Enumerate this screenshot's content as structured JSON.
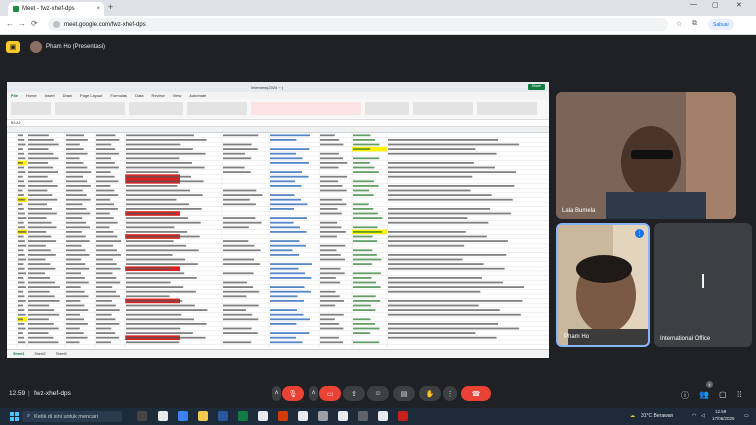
{
  "browser": {
    "tab_title": "Meet - fwz-xhef-dps",
    "tab_close": "×",
    "new_tab": "+",
    "address": "meet.google.com/fwz-xhef-dps",
    "profile_label": "Sabuai",
    "nav_back": "←",
    "nav_forward": "→",
    "nav_reload": "⟳",
    "win_min": "—",
    "win_max": "▢",
    "win_close": "✕"
  },
  "meet": {
    "presenter_label": "Pham Ho (Presentasi)",
    "participants": [
      {
        "name": "Lala Bumela"
      },
      {
        "name": "Pham Ho"
      },
      {
        "name": "International Office",
        "initial": "I"
      }
    ],
    "time": "12.59",
    "separator": "|",
    "meeting_code": "fwz-xhef-dps",
    "participant_count": "4"
  },
  "excel": {
    "title": "Interview(2024 ~ )",
    "menu": [
      "File",
      "Home",
      "Insert",
      "Draw",
      "Page Layout",
      "Formulas",
      "Data",
      "Review",
      "View",
      "Automate"
    ],
    "share_label": "Share",
    "formula_ref": "B2:A2",
    "sheets": [
      "Sheet1",
      "Sheet2",
      "Sheet3"
    ]
  },
  "taskbar": {
    "search_placeholder": "Ketik di sini untuk mencari",
    "weather": "31°C Berawan",
    "clock_time": "12.59",
    "clock_date": "17/06/2025"
  },
  "colors": {
    "meet_bg": "#202124",
    "excel_green": "#107c41",
    "hangup_red": "#ea4335",
    "highlight_red": "#e02020",
    "highlight_yellow": "#fff200"
  },
  "icons": [
    "mic-off-icon",
    "camera-off-icon",
    "present-icon",
    "emoji-icon",
    "captions-icon",
    "raise-hand-icon",
    "more-icon",
    "hang-up-icon",
    "info-icon",
    "people-icon",
    "chat-icon",
    "activities-icon"
  ]
}
